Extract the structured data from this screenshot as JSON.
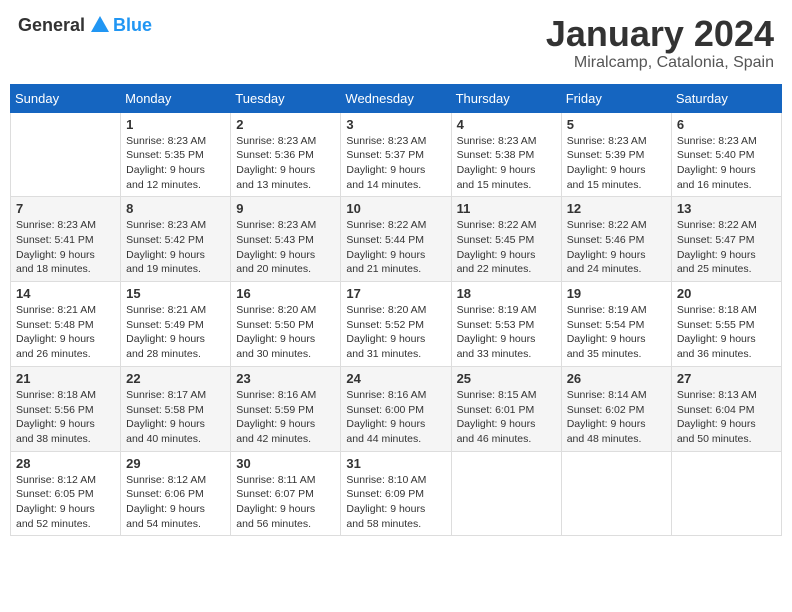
{
  "logo": {
    "text_general": "General",
    "text_blue": "Blue"
  },
  "title": "January 2024",
  "location": "Miralcamp, Catalonia, Spain",
  "weekdays": [
    "Sunday",
    "Monday",
    "Tuesday",
    "Wednesday",
    "Thursday",
    "Friday",
    "Saturday"
  ],
  "weeks": [
    [
      {
        "day": "",
        "info": ""
      },
      {
        "day": "1",
        "info": "Sunrise: 8:23 AM\nSunset: 5:35 PM\nDaylight: 9 hours\nand 12 minutes."
      },
      {
        "day": "2",
        "info": "Sunrise: 8:23 AM\nSunset: 5:36 PM\nDaylight: 9 hours\nand 13 minutes."
      },
      {
        "day": "3",
        "info": "Sunrise: 8:23 AM\nSunset: 5:37 PM\nDaylight: 9 hours\nand 14 minutes."
      },
      {
        "day": "4",
        "info": "Sunrise: 8:23 AM\nSunset: 5:38 PM\nDaylight: 9 hours\nand 15 minutes."
      },
      {
        "day": "5",
        "info": "Sunrise: 8:23 AM\nSunset: 5:39 PM\nDaylight: 9 hours\nand 15 minutes."
      },
      {
        "day": "6",
        "info": "Sunrise: 8:23 AM\nSunset: 5:40 PM\nDaylight: 9 hours\nand 16 minutes."
      }
    ],
    [
      {
        "day": "7",
        "info": "Sunrise: 8:23 AM\nSunset: 5:41 PM\nDaylight: 9 hours\nand 18 minutes."
      },
      {
        "day": "8",
        "info": "Sunrise: 8:23 AM\nSunset: 5:42 PM\nDaylight: 9 hours\nand 19 minutes."
      },
      {
        "day": "9",
        "info": "Sunrise: 8:23 AM\nSunset: 5:43 PM\nDaylight: 9 hours\nand 20 minutes."
      },
      {
        "day": "10",
        "info": "Sunrise: 8:22 AM\nSunset: 5:44 PM\nDaylight: 9 hours\nand 21 minutes."
      },
      {
        "day": "11",
        "info": "Sunrise: 8:22 AM\nSunset: 5:45 PM\nDaylight: 9 hours\nand 22 minutes."
      },
      {
        "day": "12",
        "info": "Sunrise: 8:22 AM\nSunset: 5:46 PM\nDaylight: 9 hours\nand 24 minutes."
      },
      {
        "day": "13",
        "info": "Sunrise: 8:22 AM\nSunset: 5:47 PM\nDaylight: 9 hours\nand 25 minutes."
      }
    ],
    [
      {
        "day": "14",
        "info": "Sunrise: 8:21 AM\nSunset: 5:48 PM\nDaylight: 9 hours\nand 26 minutes."
      },
      {
        "day": "15",
        "info": "Sunrise: 8:21 AM\nSunset: 5:49 PM\nDaylight: 9 hours\nand 28 minutes."
      },
      {
        "day": "16",
        "info": "Sunrise: 8:20 AM\nSunset: 5:50 PM\nDaylight: 9 hours\nand 30 minutes."
      },
      {
        "day": "17",
        "info": "Sunrise: 8:20 AM\nSunset: 5:52 PM\nDaylight: 9 hours\nand 31 minutes."
      },
      {
        "day": "18",
        "info": "Sunrise: 8:19 AM\nSunset: 5:53 PM\nDaylight: 9 hours\nand 33 minutes."
      },
      {
        "day": "19",
        "info": "Sunrise: 8:19 AM\nSunset: 5:54 PM\nDaylight: 9 hours\nand 35 minutes."
      },
      {
        "day": "20",
        "info": "Sunrise: 8:18 AM\nSunset: 5:55 PM\nDaylight: 9 hours\nand 36 minutes."
      }
    ],
    [
      {
        "day": "21",
        "info": "Sunrise: 8:18 AM\nSunset: 5:56 PM\nDaylight: 9 hours\nand 38 minutes."
      },
      {
        "day": "22",
        "info": "Sunrise: 8:17 AM\nSunset: 5:58 PM\nDaylight: 9 hours\nand 40 minutes."
      },
      {
        "day": "23",
        "info": "Sunrise: 8:16 AM\nSunset: 5:59 PM\nDaylight: 9 hours\nand 42 minutes."
      },
      {
        "day": "24",
        "info": "Sunrise: 8:16 AM\nSunset: 6:00 PM\nDaylight: 9 hours\nand 44 minutes."
      },
      {
        "day": "25",
        "info": "Sunrise: 8:15 AM\nSunset: 6:01 PM\nDaylight: 9 hours\nand 46 minutes."
      },
      {
        "day": "26",
        "info": "Sunrise: 8:14 AM\nSunset: 6:02 PM\nDaylight: 9 hours\nand 48 minutes."
      },
      {
        "day": "27",
        "info": "Sunrise: 8:13 AM\nSunset: 6:04 PM\nDaylight: 9 hours\nand 50 minutes."
      }
    ],
    [
      {
        "day": "28",
        "info": "Sunrise: 8:12 AM\nSunset: 6:05 PM\nDaylight: 9 hours\nand 52 minutes."
      },
      {
        "day": "29",
        "info": "Sunrise: 8:12 AM\nSunset: 6:06 PM\nDaylight: 9 hours\nand 54 minutes."
      },
      {
        "day": "30",
        "info": "Sunrise: 8:11 AM\nSunset: 6:07 PM\nDaylight: 9 hours\nand 56 minutes."
      },
      {
        "day": "31",
        "info": "Sunrise: 8:10 AM\nSunset: 6:09 PM\nDaylight: 9 hours\nand 58 minutes."
      },
      {
        "day": "",
        "info": ""
      },
      {
        "day": "",
        "info": ""
      },
      {
        "day": "",
        "info": ""
      }
    ]
  ]
}
